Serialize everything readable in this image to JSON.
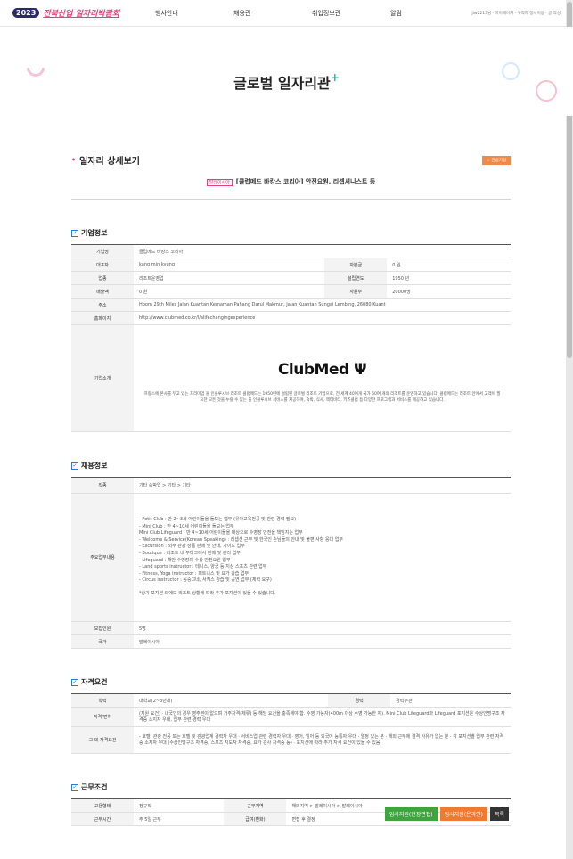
{
  "header": {
    "logo_year": "2023",
    "logo_name": "전북산업 일자리박람회",
    "nav": [
      "행사안내",
      "채용관",
      "취업정보관",
      "알림"
    ],
    "util": "jiw2213님 · 마이페이지 · 구직자 정시이용 · 글 작성"
  },
  "hero": {
    "title": "글로벌 일자리관",
    "plus": "+"
  },
  "detail": {
    "heading": "일자리 상세보기",
    "fav_label": "☆ 관심기업",
    "badge": "말레이시아",
    "job_title": "[클럽메드 바캉스 코리아] 안전요원, 리셉셔니스트 등"
  },
  "company": {
    "section": "기업정보",
    "labels": {
      "name": "기업명",
      "ceo": "대표자",
      "capital": "자본금",
      "type": "업종",
      "founded": "설립연도",
      "revenue": "매출액",
      "employees": "사원수",
      "address": "주소",
      "homepage": "홈페이지",
      "intro": "기업소개"
    },
    "name": "클럽메드 바캉스 코리아",
    "ceo": "kang min kyung",
    "capital": "0 원",
    "type": "리조트운영업",
    "founded": "1950 년",
    "revenue": "0 원",
    "employees": "20000명",
    "address": "Hbom 29th Miles Jalan Kuantan Kemaman Pahang Darul Makmur, Jalan Kuantan Sungai Lembing, 26080 Kuant",
    "homepage": "http://www.clubmed.co.kr/l/alifechangingexperience",
    "brand": "ClubMed",
    "intro": "프랑스에 본사를 두고 있는 프리미엄 올 인클루시브 리조트 클럽메드는 1950년에 설립된 글로벌 리조트 기업으로, 전 세계 40여개 국가 60여 개의 리조트를 운영하고 있습니다. 클럽메드는 리조트 안에서 고객이 필요한 모든 것을 누릴 수 있는 올 인클루시브 서비스를 제공하며, 숙박, 식사, 액티비티, 키즈클럽 등 다양한 프로그램과 서비스를 제공하고 있습니다."
  },
  "recruit": {
    "section": "채용정보",
    "labels": {
      "job": "직종",
      "duty": "주요업무내용",
      "count": "모집인원",
      "country": "국가"
    },
    "job": "기타 숙박업 > 기타 > 기타",
    "duty": "- Petit Club : 만 2~3세 어린이들을 돌보는 업무 (유아교육전공 및 관련 경력 필요)\n- Mini Club : 만 4~10세 어린이들을 돌보는 업무\n  Mini Club Lifeguard : 만 4~10세 어린이들을 대상으로 수영장 안전을 책임지는 업무\n- Welcome & Service(Korean Speaking) : 리셉션 근무 및 한국인 손님들의 안내 및 불편 사항 응대 업무\n- Excursion : 외부 관광 상품 판매 및 안내, 가이드 업무\n- Boutique : 리조트 내 부티크에서 판매 및 관리 업무\n- Lifeguard : 해안 수영장의 수상 안전요원 업무\n- Land sports instructor : 테니스, 양궁 등 지상 스포츠 관련 업무\n- Fitness, Yoga instructor : 피트니스 및 요가 강습 업무\n- Circus instructor : 공중그네, 서커스 강습 및 공연 업무 (체력 요구)\n\n*상기 포지션 외에도 리조트 상황에 따라 추가 포지션이 있을 수 있습니다.",
    "count": "5명",
    "country": "말레이시아"
  },
  "qualification": {
    "section": "자격요건",
    "labels": {
      "edu": "학력",
      "career": "경력",
      "license": "자격/면허",
      "etc": "그 외 자격요건"
    },
    "edu": "대학교(2~3년제)",
    "career": "경력무관",
    "career_label": "경력",
    "license": "(지원 요건) · 내국인의 경우 영주권이 없으며 거주자격(체류) 등 해당 요건을 충족해야 함. 수영 가능자(400m 이상 수영 가능한 자). Mini Club Lifeguard와 Lifeguard 포지션은 수상인명구조 자격증 소지자 우대, 업무 관련 경력 우대",
    "etc": "- 호텔, 관광 전공 또는 호텔 및 관광업계 경력자 우대 · 서비스업 관련 경력자 우대 · 영어, 일어 등 외국어 능통자 우대 · 열정 있는 분 · 해외 근무에 결격 사유가 없는 분 · 각 포지션별 업무 관련 자격증 소지자 우대 (수상인명구조 자격증, 스포츠 지도자 자격증, 요가 강사 자격증 등) · 포지션에 따라 추가 자격 요건이 있을 수 있음"
  },
  "work": {
    "section": "근무조건",
    "labels": {
      "emp_type": "고용형태",
      "area": "근무지역",
      "hours": "근무시간",
      "salary": "급여(환화)"
    },
    "emp_type": "정규직",
    "area": "해외지역 > 말레이시아 > 말레이시아",
    "hours": "주 5일 근무",
    "salary": "면접 후 결정"
  },
  "buttons": {
    "apply_offline": "입사지원(현장면접)",
    "apply_online": "입사지원(온라인)",
    "list": "목록",
    "colors": {
      "offline": "#3fa33f",
      "online": "#f07a32",
      "list": "#333333"
    }
  }
}
